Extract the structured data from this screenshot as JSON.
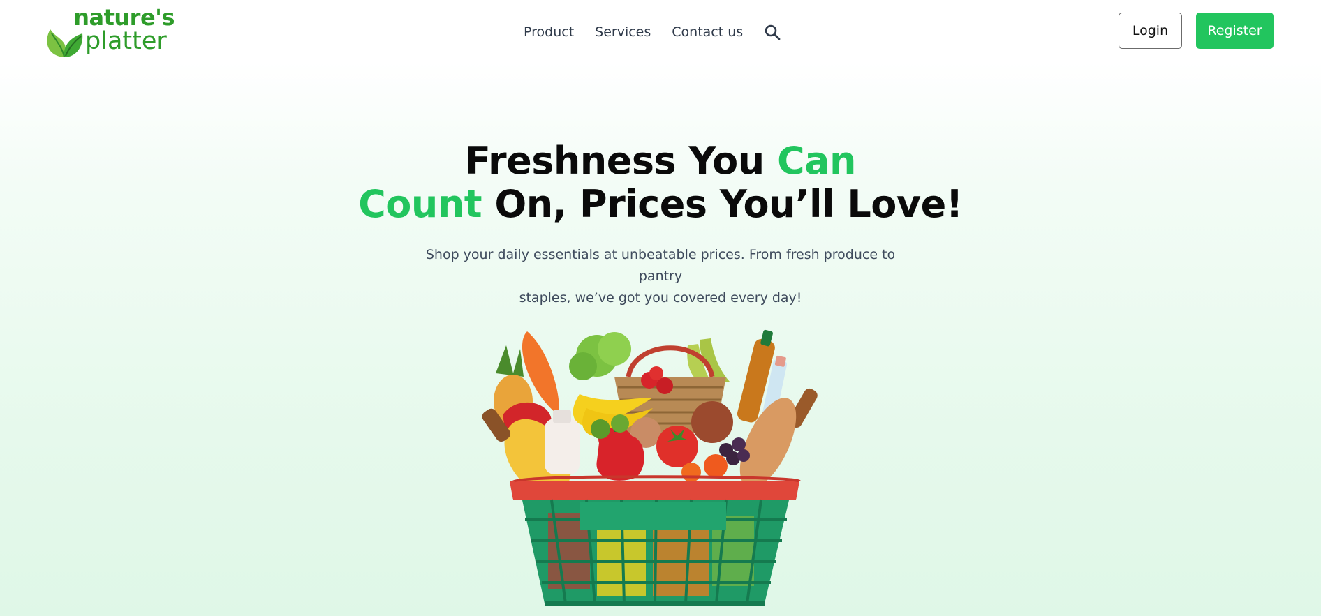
{
  "brand": {
    "line1": "nature's",
    "line2": "platter"
  },
  "nav": {
    "items": [
      "Product",
      "Services",
      "Contact us"
    ]
  },
  "auth": {
    "login_label": "Login",
    "register_label": "Register"
  },
  "hero": {
    "title_part1": "Freshness You ",
    "title_highlight1": "Can",
    "title_highlight2": "Count",
    "title_part2": " On, Prices You’ll Love!",
    "subtitle_line1": "Shop your daily essentials at unbeatable prices. From fresh produce to pantry",
    "subtitle_line2": "staples, we’ve got you covered every day!"
  },
  "colors": {
    "accent": "#22c55e",
    "logo": "#2e9c2a",
    "nav_text": "#2f3a4a"
  },
  "icons": {
    "search": "search-icon",
    "logo": "leaf-icon"
  }
}
